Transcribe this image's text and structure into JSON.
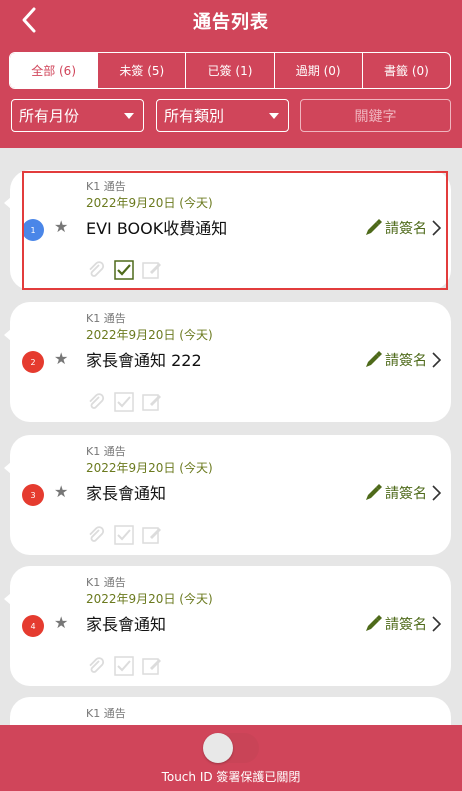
{
  "header": {
    "title": "通告列表"
  },
  "tabs": [
    {
      "label": "全部 (6)"
    },
    {
      "label": "未簽 (5)"
    },
    {
      "label": "已簽 (1)"
    },
    {
      "label": "過期 (0)"
    },
    {
      "label": "書籤 (0)"
    }
  ],
  "filters": {
    "month": "所有月份",
    "category": "所有類別",
    "keyword_placeholder": "關鍵字"
  },
  "notices": [
    {
      "number": "1",
      "category": "K1 通告",
      "date": "2022年9月20日 (今天)",
      "title": "EVI BOOK收費通知",
      "action": "請簽名",
      "badge_color": "#4a86e8",
      "signed": true
    },
    {
      "number": "2",
      "category": "K1 通告",
      "date": "2022年9月20日 (今天)",
      "title": "家長會通知 222",
      "action": "請簽名",
      "badge_color": "#e53b2f",
      "signed": false
    },
    {
      "number": "3",
      "category": "K1 通告",
      "date": "2022年9月20日 (今天)",
      "title": "家長會通知",
      "action": "請簽名",
      "badge_color": "#e53b2f",
      "signed": false
    },
    {
      "number": "4",
      "category": "K1 通告",
      "date": "2022年9月20日 (今天)",
      "title": "家長會通知",
      "action": "請簽名",
      "badge_color": "#e53b2f",
      "signed": false
    },
    {
      "number": "",
      "category": "K1 通告",
      "date": "",
      "title": "",
      "action": "",
      "badge_color": "#e53b2f",
      "signed": false
    }
  ],
  "footer": {
    "touch_id_text": "Touch ID 簽署保護已關閉"
  }
}
